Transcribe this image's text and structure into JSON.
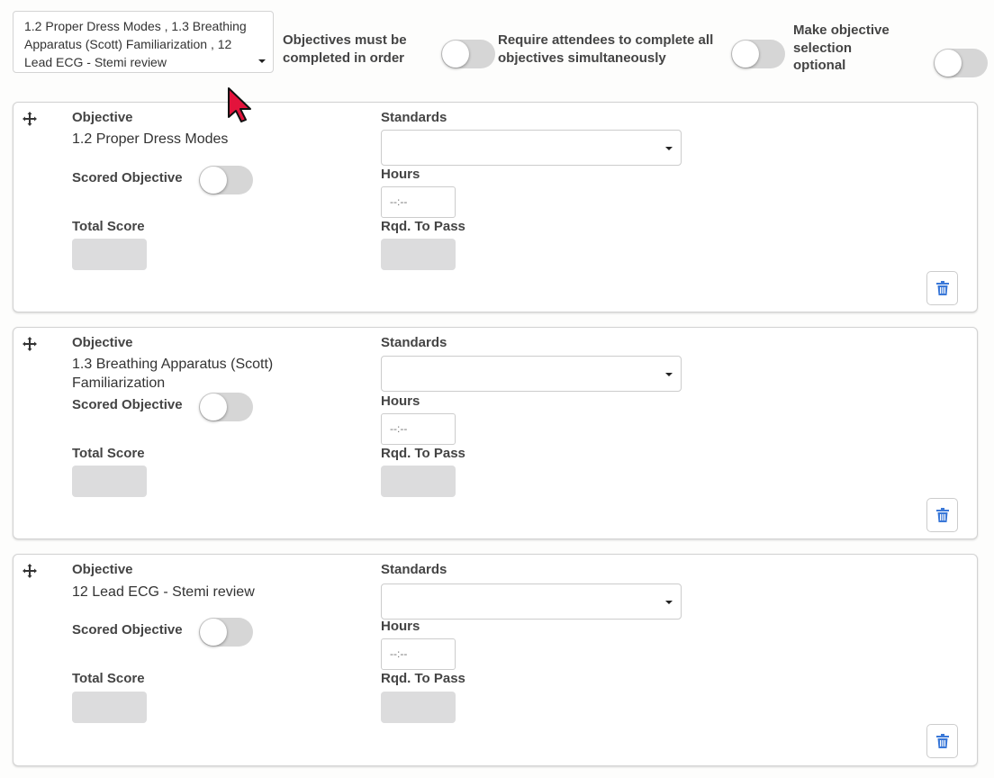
{
  "objectives_select": {
    "value": "1.2 Proper Dress Modes , 1.3 Breathing Apparatus (Scott) Familiarization , 12 Lead ECG - Stemi review"
  },
  "settings": {
    "in_order_label": "Objectives must be completed in order",
    "simultaneous_label": "Require attendees to complete all objectives simultaneously",
    "optional_label": "Make objective selection optional"
  },
  "field_labels": {
    "objective": "Objective",
    "standards": "Standards",
    "scored_objective": "Scored Objective",
    "hours": "Hours",
    "total_score": "Total Score",
    "rqd_to_pass": "Rqd. To Pass",
    "hours_placeholder": "--:--"
  },
  "objectives": [
    {
      "name": "1.2 Proper Dress Modes"
    },
    {
      "name": "1.3 Breathing Apparatus (Scott) Familiarization"
    },
    {
      "name": "12 Lead ECG - Stemi review"
    }
  ],
  "colors": {
    "toggle_off": "#d6d6d6",
    "trash_icon": "#3a78d8",
    "cursor": "#e3133c"
  }
}
